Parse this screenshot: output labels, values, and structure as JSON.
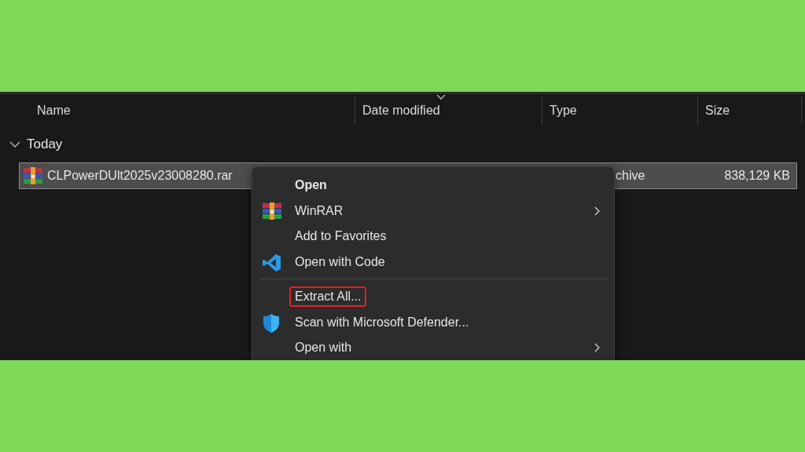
{
  "columns": [
    {
      "label": "Name"
    },
    {
      "label": "Date modified",
      "sorted": true
    },
    {
      "label": "Type"
    },
    {
      "label": "Size"
    }
  ],
  "group": {
    "label": "Today",
    "expanded": true
  },
  "rows": [
    {
      "name": "CLPowerDUlt2025v23008280.rar",
      "type": "chive",
      "size": "838,129 KB",
      "selected": true
    }
  ],
  "context_menu": [
    {
      "kind": "item",
      "label": "Open",
      "bold": true
    },
    {
      "kind": "item",
      "label": "WinRAR",
      "submenu": true
    },
    {
      "kind": "item",
      "label": "Add to Favorites"
    },
    {
      "kind": "item",
      "label": "Open with Code"
    },
    {
      "kind": "separator"
    },
    {
      "kind": "item",
      "label": "Extract All...",
      "highlighted": true
    },
    {
      "kind": "item",
      "label": "Scan with Microsoft Defender..."
    },
    {
      "kind": "item",
      "label": "Open with",
      "submenu": true
    }
  ]
}
